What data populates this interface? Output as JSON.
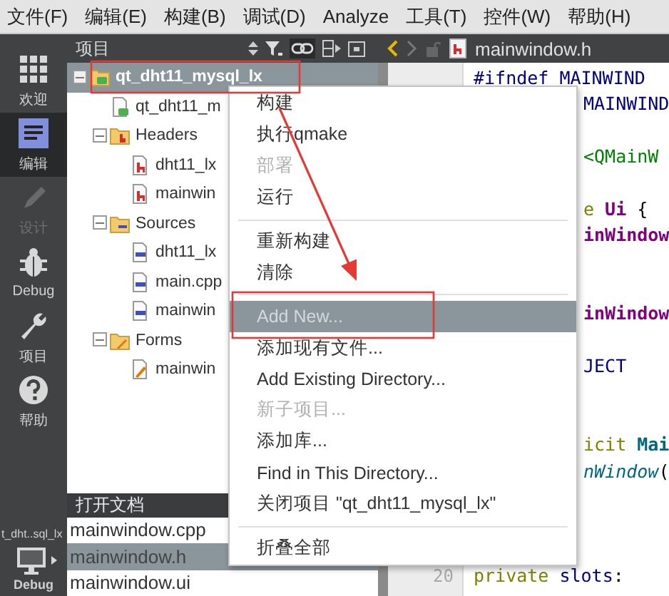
{
  "menubar": [
    {
      "label": "文件(F)"
    },
    {
      "label": "编辑(E)"
    },
    {
      "label": "构建(B)"
    },
    {
      "label": "调试(D)"
    },
    {
      "label": "Analyze"
    },
    {
      "label": "工具(T)"
    },
    {
      "label": "控件(W)"
    },
    {
      "label": "帮助(H)"
    }
  ],
  "modes": [
    {
      "kind": "welcome",
      "label": "欢迎",
      "selected": false,
      "disabled": false
    },
    {
      "kind": "edit",
      "label": "编辑",
      "selected": true,
      "disabled": false
    },
    {
      "kind": "design",
      "label": "设计",
      "selected": false,
      "disabled": true
    },
    {
      "kind": "debug",
      "label": "Debug",
      "selected": false,
      "disabled": false
    },
    {
      "kind": "project",
      "label": "项目",
      "selected": false,
      "disabled": false
    },
    {
      "kind": "help",
      "label": "帮助",
      "selected": false,
      "disabled": false
    }
  ],
  "target": {
    "project": "t_dht..sql_lx",
    "build": "Debug"
  },
  "project_panel": {
    "title": "项目",
    "tree": [
      {
        "kind": "project",
        "label": "qt_dht11_mysql_lx",
        "selected": true,
        "expanded": true,
        "children": [
          {
            "kind": "pro",
            "label": "qt_dht11_m",
            "selected": false
          },
          {
            "kind": "headers",
            "label": "Headers",
            "selected": false,
            "expanded": true,
            "children": [
              {
                "kind": "header",
                "label": "dht11_lx",
                "selected": false
              },
              {
                "kind": "header",
                "label": "mainwin",
                "selected": false
              }
            ]
          },
          {
            "kind": "sources",
            "label": "Sources",
            "selected": false,
            "expanded": true,
            "children": [
              {
                "kind": "source",
                "label": "dht11_lx",
                "selected": false
              },
              {
                "kind": "source",
                "label": "main.cpp",
                "selected": false
              },
              {
                "kind": "source",
                "label": "mainwin",
                "selected": false
              }
            ]
          },
          {
            "kind": "forms",
            "label": "Forms",
            "selected": false,
            "expanded": true,
            "children": [
              {
                "kind": "form",
                "label": "mainwin",
                "selected": false
              }
            ]
          }
        ]
      }
    ]
  },
  "open_documents": {
    "title": "打开文档",
    "items": [
      {
        "label": "mainwindow.cpp",
        "selected": false
      },
      {
        "label": "mainwindow.h",
        "selected": true
      },
      {
        "label": "mainwindow.ui",
        "selected": false
      }
    ]
  },
  "editor": {
    "file": "mainwindow.h",
    "lines": [
      {
        "kind": "full",
        "segments": [
          {
            "kind": "preproc",
            "text": "#ifndef MAINWIND"
          }
        ]
      },
      {
        "kind": "clipped",
        "segments": [
          {
            "kind": "preproc",
            "text": "MAINWIND"
          }
        ]
      },
      {
        "kind": "covered"
      },
      {
        "kind": "clipped",
        "segments": [
          {
            "kind": "string",
            "text": "<QMainW"
          }
        ]
      },
      {
        "kind": "covered"
      },
      {
        "kind": "clipped",
        "segments": [
          {
            "kind": "keyword",
            "text": "e"
          },
          {
            "kind": "type",
            "text": " Ui"
          },
          {
            "kind": "plain",
            "text": " {"
          }
        ]
      },
      {
        "kind": "clipped",
        "segments": [
          {
            "kind": "type",
            "text": "inWindow"
          }
        ]
      },
      {
        "kind": "covered"
      },
      {
        "kind": "covered"
      },
      {
        "kind": "clipped",
        "segments": [
          {
            "kind": "type",
            "text": "inWindow"
          }
        ]
      },
      {
        "kind": "covered"
      },
      {
        "kind": "clipped",
        "segments": [
          {
            "kind": "preproc",
            "text": "JECT"
          }
        ]
      },
      {
        "kind": "covered"
      },
      {
        "kind": "covered"
      },
      {
        "kind": "clipped",
        "segments": [
          {
            "kind": "keyword",
            "text": "icit"
          },
          {
            "kind": "class",
            "text": " Mai"
          }
        ]
      },
      {
        "kind": "clipped",
        "segments": [
          {
            "kind": "function",
            "text": "nWindow"
          },
          {
            "kind": "plain",
            "text": "("
          }
        ]
      },
      {
        "kind": "covered"
      },
      {
        "kind": "covered"
      },
      {
        "kind": "covered"
      },
      {
        "kind": "full",
        "number": "20",
        "segments": [
          {
            "kind": "keyword",
            "text": "private"
          },
          {
            "kind": "preproc",
            "text": " slots"
          },
          {
            "kind": "plain",
            "text": ":"
          }
        ]
      }
    ]
  },
  "context_menu": [
    {
      "kind": "item",
      "label": "构建",
      "disabled": false,
      "selected": false
    },
    {
      "kind": "item",
      "label": "执行qmake",
      "disabled": false,
      "selected": false
    },
    {
      "kind": "item",
      "label": "部署",
      "disabled": true,
      "selected": false
    },
    {
      "kind": "item",
      "label": "运行",
      "disabled": false,
      "selected": false
    },
    {
      "kind": "separator"
    },
    {
      "kind": "item",
      "label": "重新构建",
      "disabled": false,
      "selected": false
    },
    {
      "kind": "item",
      "label": "清除",
      "disabled": false,
      "selected": false
    },
    {
      "kind": "separator"
    },
    {
      "kind": "item",
      "label": "Add New...",
      "disabled": false,
      "selected": true
    },
    {
      "kind": "item",
      "label": "添加现有文件...",
      "disabled": false,
      "selected": false
    },
    {
      "kind": "item",
      "label": "Add Existing Directory...",
      "disabled": false,
      "selected": false
    },
    {
      "kind": "item",
      "label": "新子项目...",
      "disabled": true,
      "selected": false
    },
    {
      "kind": "item",
      "label": "添加库...",
      "disabled": false,
      "selected": false
    },
    {
      "kind": "item",
      "label": "Find in This Directory...",
      "disabled": false,
      "selected": false
    },
    {
      "kind": "item",
      "label": "关闭项目 \"qt_dht11_mysql_lx\"",
      "disabled": false,
      "selected": false
    },
    {
      "kind": "separator"
    },
    {
      "kind": "item",
      "label": "折叠全部",
      "disabled": false,
      "selected": false
    }
  ]
}
